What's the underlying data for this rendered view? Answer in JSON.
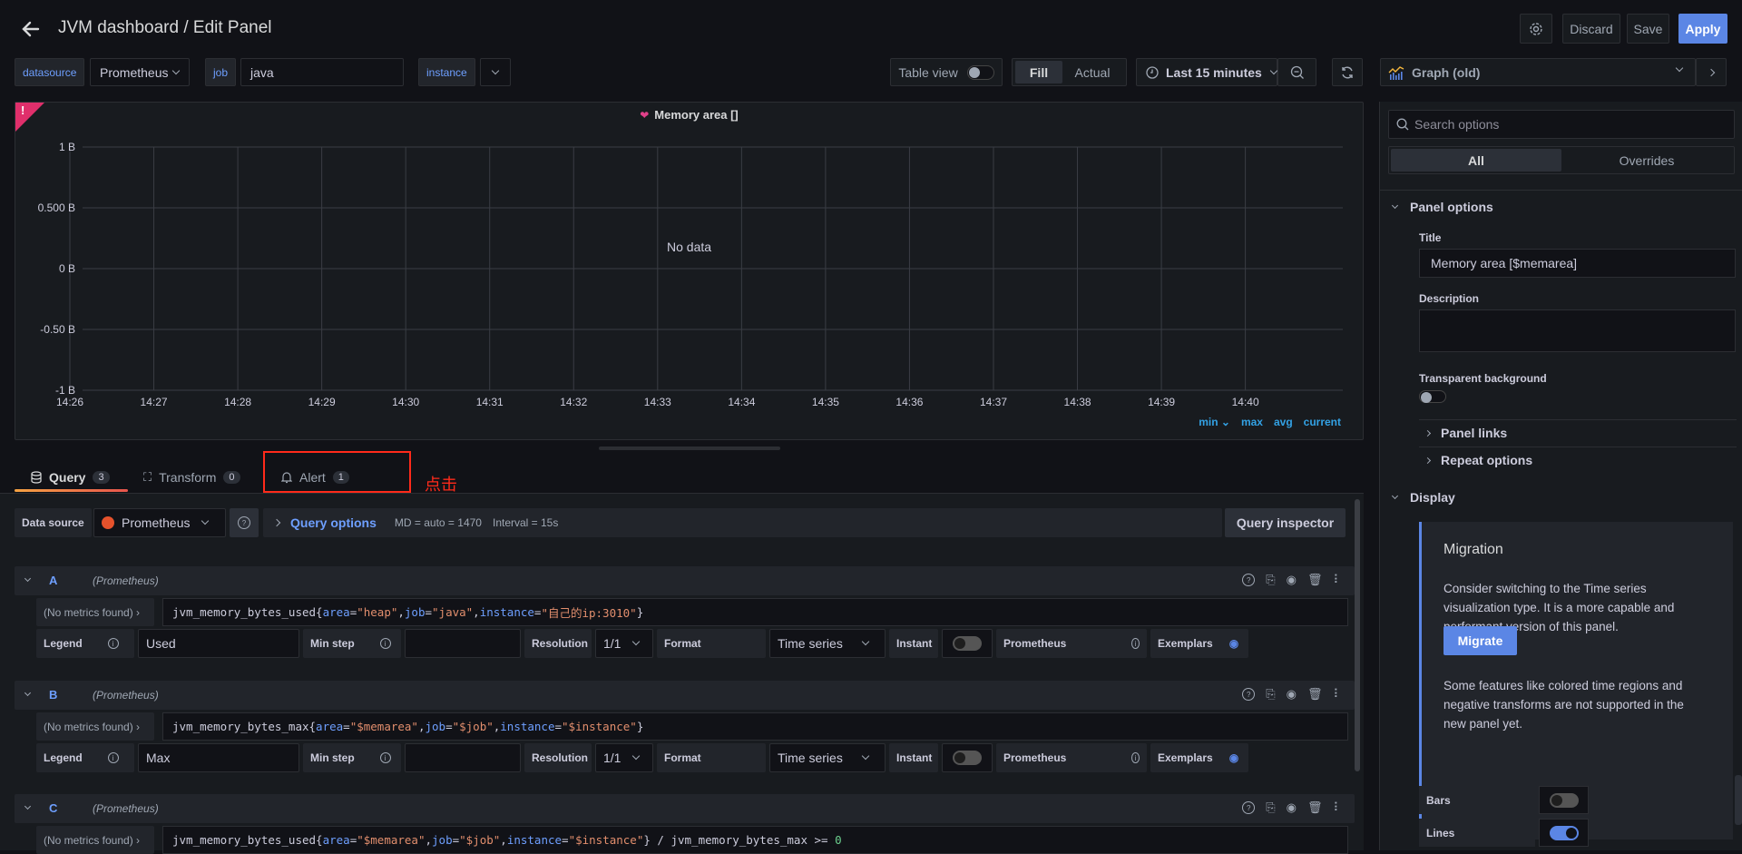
{
  "header": {
    "title": "JVM dashboard / Edit Panel",
    "discard_label": "Discard",
    "save_label": "Save",
    "apply_label": "Apply"
  },
  "variables": {
    "datasource_label": "datasource",
    "datasource_value": "Prometheus",
    "job_label": "job",
    "job_value": "java",
    "instance_label": "instance",
    "instance_value": ""
  },
  "toolbar": {
    "table_view_label": "Table view",
    "table_view_on": false,
    "fill_label": "Fill",
    "actual_label": "Actual",
    "time_range": "Last 15 minutes",
    "visualization": "Graph (old)"
  },
  "panel": {
    "title": "Memory area []",
    "no_data": "No data",
    "legend_items": [
      "min",
      "max",
      "avg",
      "current"
    ]
  },
  "chart_data": {
    "type": "line",
    "title": "Memory area []",
    "xlabel": "",
    "ylabel": "",
    "x_ticks": [
      "14:26",
      "14:27",
      "14:28",
      "14:29",
      "14:30",
      "14:31",
      "14:32",
      "14:33",
      "14:34",
      "14:35",
      "14:36",
      "14:37",
      "14:38",
      "14:39",
      "14:40"
    ],
    "y_ticks": [
      "1 B",
      "0.500 B",
      "0 B",
      "-0.50 B",
      "-1 B"
    ],
    "y_tick_values": [
      1,
      0.5,
      0,
      -0.5,
      -1
    ],
    "ylim": [
      -1,
      1
    ],
    "series": [],
    "grid": true,
    "annotation": "No data",
    "legend": [
      "min",
      "max",
      "avg",
      "current"
    ]
  },
  "tabs": [
    {
      "label": "Query",
      "count": "3",
      "active": true
    },
    {
      "label": "Transform",
      "count": "0",
      "active": false
    },
    {
      "label": "Alert",
      "count": "1",
      "active": false
    }
  ],
  "annotation_note": "点击",
  "query_bar": {
    "datasource_label": "Data source",
    "datasource_value": "Prometheus",
    "query_options_label": "Query options",
    "md": "MD = auto = 1470",
    "interval": "Interval = 15s",
    "inspector_label": "Query inspector"
  },
  "queries": [
    {
      "letter": "A",
      "datasource": "(Prometheus)",
      "metrics_label": "(No metrics found)",
      "expr_parts": [
        {
          "t": "jvm_memory_bytes_used{",
          "c": ""
        },
        {
          "t": "area",
          "c": "k"
        },
        {
          "t": "=",
          "c": ""
        },
        {
          "t": "\"heap\"",
          "c": "s"
        },
        {
          "t": ",",
          "c": ""
        },
        {
          "t": "job",
          "c": "k"
        },
        {
          "t": "=",
          "c": ""
        },
        {
          "t": "\"java\"",
          "c": "s"
        },
        {
          "t": ",",
          "c": ""
        },
        {
          "t": "instance",
          "c": "k"
        },
        {
          "t": "=",
          "c": ""
        },
        {
          "t": "\"自己的ip:3010\"",
          "c": "s"
        },
        {
          "t": "}",
          "c": ""
        }
      ],
      "legend_label": "Legend",
      "legend_value": "Used",
      "min_step_label": "Min step",
      "min_step_value": "",
      "resolution_label": "Resolution",
      "resolution_value": "1/1",
      "format_label": "Format",
      "format_value": "Time series",
      "instant_label": "Instant",
      "instant_on": false,
      "type_label": "Prometheus",
      "exemplars_label": "Exemplars"
    },
    {
      "letter": "B",
      "datasource": "(Prometheus)",
      "metrics_label": "(No metrics found)",
      "expr_parts": [
        {
          "t": "jvm_memory_bytes_max{",
          "c": ""
        },
        {
          "t": "area",
          "c": "k"
        },
        {
          "t": "=",
          "c": ""
        },
        {
          "t": "\"$memarea\"",
          "c": "s"
        },
        {
          "t": ",",
          "c": ""
        },
        {
          "t": "job",
          "c": "k"
        },
        {
          "t": "=",
          "c": ""
        },
        {
          "t": "\"$job\"",
          "c": "s"
        },
        {
          "t": ",",
          "c": ""
        },
        {
          "t": "instance",
          "c": "k"
        },
        {
          "t": "=",
          "c": ""
        },
        {
          "t": "\"$instance\"",
          "c": "s"
        },
        {
          "t": "}",
          "c": ""
        }
      ],
      "legend_label": "Legend",
      "legend_value": "Max",
      "min_step_label": "Min step",
      "min_step_value": "",
      "resolution_label": "Resolution",
      "resolution_value": "1/1",
      "format_label": "Format",
      "format_value": "Time series",
      "instant_label": "Instant",
      "instant_on": false,
      "type_label": "Prometheus",
      "exemplars_label": "Exemplars"
    },
    {
      "letter": "C",
      "datasource": "(Prometheus)",
      "metrics_label": "(No metrics found)",
      "expr_parts": [
        {
          "t": "jvm_memory_bytes_used{",
          "c": ""
        },
        {
          "t": "area",
          "c": "k"
        },
        {
          "t": "=",
          "c": ""
        },
        {
          "t": "\"$memarea\"",
          "c": "s"
        },
        {
          "t": ",",
          "c": ""
        },
        {
          "t": "job",
          "c": "k"
        },
        {
          "t": "=",
          "c": ""
        },
        {
          "t": "\"$job\"",
          "c": "s"
        },
        {
          "t": ",",
          "c": ""
        },
        {
          "t": "instance",
          "c": "k"
        },
        {
          "t": "=",
          "c": ""
        },
        {
          "t": "\"$instance\"",
          "c": "s"
        },
        {
          "t": "} / jvm_memory_bytes_max >= ",
          "c": ""
        },
        {
          "t": "0",
          "c": "n"
        }
      ]
    }
  ],
  "options_pane": {
    "search_placeholder": "Search options",
    "tab_all": "All",
    "tab_overrides": "Overrides",
    "panel_options_label": "Panel options",
    "title_label": "Title",
    "title_value": "Memory area [$memarea]",
    "description_label": "Description",
    "description_value": "",
    "transparent_label": "Transparent background",
    "transparent_on": false,
    "panel_links_label": "Panel links",
    "repeat_options_label": "Repeat options",
    "display_label": "Display",
    "migration_title": "Migration",
    "migration_text": "Consider switching to the Time series visualization type. It is a more capable and performant version of this panel.",
    "migrate_label": "Migrate",
    "migration_note": "Some features like colored time regions and negative transforms are not supported in the new panel yet.",
    "bars_label": "Bars",
    "bars_on": false,
    "lines_label": "Lines",
    "lines_on": true
  },
  "colors": {
    "accent": "#5b86e5",
    "apply": "#3d71d9",
    "alert_corner": "#e02f6b",
    "tab_underline": "#f46a45",
    "annotation_red": "#ff2a1a"
  }
}
